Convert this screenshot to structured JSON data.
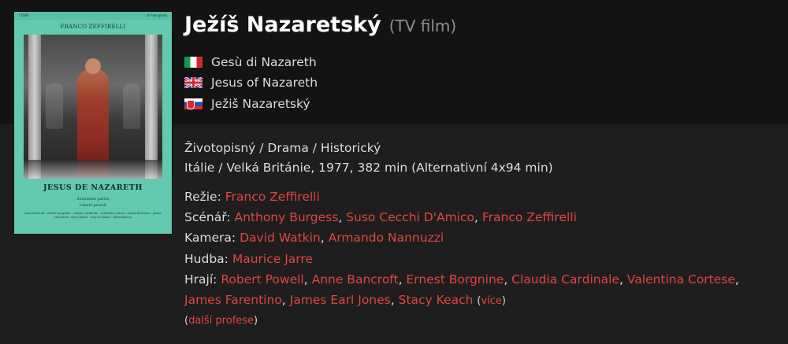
{
  "title": "Ježíš Nazaretský",
  "type_label": "(TV film)",
  "poster": {
    "top_left": "COINE",
    "top_right": "sir lew grade",
    "director": "FRANCO ZEFFIRELLI",
    "title": "JESUS DE NAZARETH",
    "line1": "deuxieme partie",
    "line2": "robert powell",
    "credits": "anne bancroft · ernest borgnine · claudia cardinale · valentina cortese · james farentino · james earl jones · stacy keach · tony lo bianco · olivia hussey"
  },
  "alternate_titles": [
    {
      "flag": "italy-flag",
      "title": "Gesù di Nazareth"
    },
    {
      "flag": "uk-flag",
      "title": "Jesus of Nazareth"
    },
    {
      "flag": "slovakia-flag",
      "title": "Ježiš Nazaretský"
    }
  ],
  "genres": "Životopisný / Drama / Historický",
  "origin": "Itálie / Velká Británie, 1977, 382 min (Alternativní 4x94 min)",
  "crew": {
    "directing": {
      "label": "Režie:",
      "names": [
        "Franco Zeffirelli"
      ]
    },
    "screenplay": {
      "label": "Scénář:",
      "names": [
        "Anthony Burgess",
        "Suso Cecchi D'Amico",
        "Franco Zeffirelli"
      ]
    },
    "camera": {
      "label": "Kamera:",
      "names": [
        "David Watkin",
        "Armando Nannuzzi"
      ]
    },
    "music": {
      "label": "Hudba:",
      "names": [
        "Maurice Jarre"
      ]
    },
    "cast": {
      "label": "Hrají:",
      "names": [
        "Robert Powell",
        "Anne Bancroft",
        "Ernest Borgnine",
        "Claudia Cardinale",
        "Valentina Cortese",
        "James Farentino",
        "James Earl Jones",
        "Stacy Keach"
      ],
      "more": "více"
    }
  },
  "more_professions": "další profese",
  "colors": {
    "link": "#e0453f",
    "header_bg": "#131313",
    "body_bg": "#1e1e1e"
  }
}
